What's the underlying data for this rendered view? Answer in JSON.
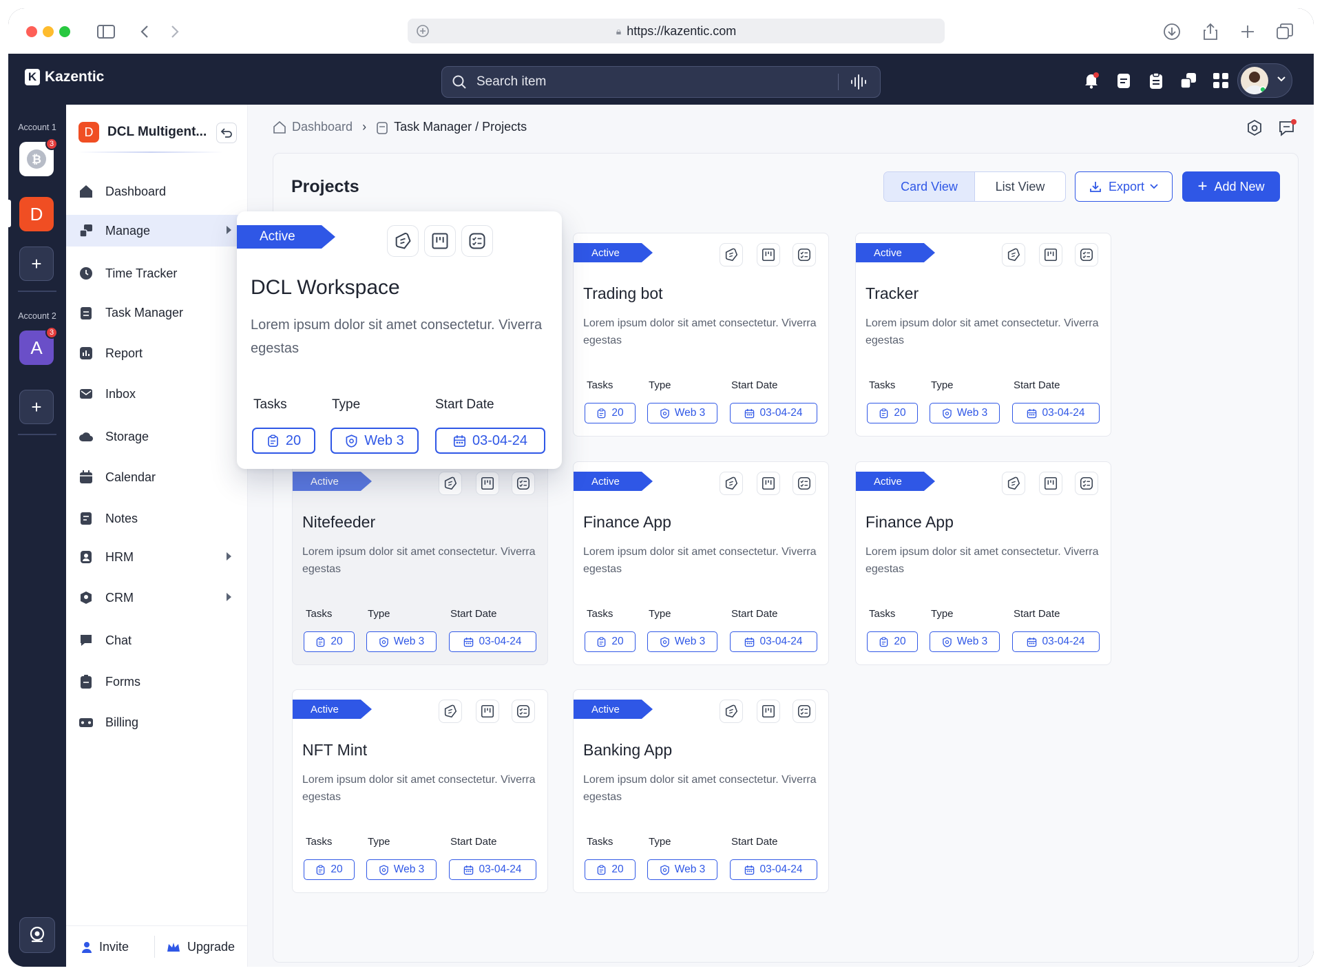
{
  "browser": {
    "url": "https://kazentic.com"
  },
  "app": {
    "name": "Kazentic",
    "logo_letter": "K",
    "search_placeholder": "Search item"
  },
  "accounts": [
    {
      "label": "Account 1",
      "badge": "3"
    },
    {
      "letter": "D"
    },
    {
      "label": "Account 2",
      "letter": "A",
      "badge": "3"
    }
  ],
  "sidebar": {
    "workspace_letter": "D",
    "workspace_name": "DCL Multigent...",
    "items": [
      {
        "label": "Dashboard",
        "icon": "home-icon"
      },
      {
        "label": "Manage",
        "icon": "manage-icon",
        "active": true
      },
      {
        "label": "Time Tracker",
        "icon": "clock-icon"
      },
      {
        "label": "Task Manager",
        "icon": "clipboard-icon"
      },
      {
        "label": "Report",
        "icon": "report-icon"
      },
      {
        "label": "Inbox",
        "icon": "inbox-icon"
      },
      {
        "label": "Storage",
        "icon": "cloud-icon"
      },
      {
        "label": "Calendar",
        "icon": "calendar-icon"
      },
      {
        "label": "Notes",
        "icon": "notes-icon"
      },
      {
        "label": "HRM",
        "icon": "hrm-icon"
      },
      {
        "label": "CRM",
        "icon": "crm-icon"
      },
      {
        "label": "Chat",
        "icon": "chat-icon"
      },
      {
        "label": "Forms",
        "icon": "forms-icon"
      },
      {
        "label": "Billing",
        "icon": "billing-icon"
      }
    ],
    "invite": "Invite",
    "upgrade": "Upgrade"
  },
  "breadcrumb": {
    "home": "Dashboard",
    "section": "Task Manager / Projects"
  },
  "page": {
    "title": "Projects",
    "card_view": "Card View",
    "list_view": "List View",
    "export": "Export",
    "add_new": "Add New"
  },
  "labels": {
    "tasks": "Tasks",
    "type": "Type",
    "start_date": "Start Date"
  },
  "popout": {
    "status": "Active",
    "title": "DCL Workspace",
    "description": "Lorem ipsum dolor sit amet consectetur. Viverra egestas",
    "tasks": "20",
    "type": "Web 3",
    "start_date": "03-04-24"
  },
  "projects": [
    {
      "status": "Active",
      "title": "Trading bot",
      "description": "Lorem ipsum dolor sit amet consectetur. Viverra egestas",
      "tasks": "20",
      "type": "Web 3",
      "start_date": "03-04-24"
    },
    {
      "status": "Active",
      "title": "Tracker",
      "description": "Lorem ipsum dolor sit amet consectetur. Viverra egestas",
      "tasks": "20",
      "type": "Web 3",
      "start_date": "03-04-24"
    },
    {
      "status": "Active",
      "title": "Nitefeeder",
      "description": "Lorem ipsum dolor sit amet consectetur. Viverra egestas",
      "tasks": "20",
      "type": "Web 3",
      "start_date": "03-04-24"
    },
    {
      "status": "Active",
      "title": "Finance App",
      "description": "Lorem ipsum dolor sit amet consectetur. Viverra egestas",
      "tasks": "20",
      "type": "Web 3",
      "start_date": "03-04-24"
    },
    {
      "status": "Active",
      "title": "Finance App",
      "description": "Lorem ipsum dolor sit amet consectetur. Viverra egestas",
      "tasks": "20",
      "type": "Web 3",
      "start_date": "03-04-24"
    },
    {
      "status": "Active",
      "title": "NFT Mint",
      "description": "Lorem ipsum dolor sit amet consectetur. Viverra egestas",
      "tasks": "20",
      "type": "Web 3",
      "start_date": "03-04-24"
    },
    {
      "status": "Active",
      "title": "Banking App",
      "description": "Lorem ipsum dolor sit amet consectetur. Viverra egestas",
      "tasks": "20",
      "type": "Web 3",
      "start_date": "03-04-24"
    }
  ],
  "colors": {
    "accent": "#2f57e6",
    "dark": "#1c2339",
    "workspace": "#f04e23",
    "account2": "#6a4fc8"
  }
}
